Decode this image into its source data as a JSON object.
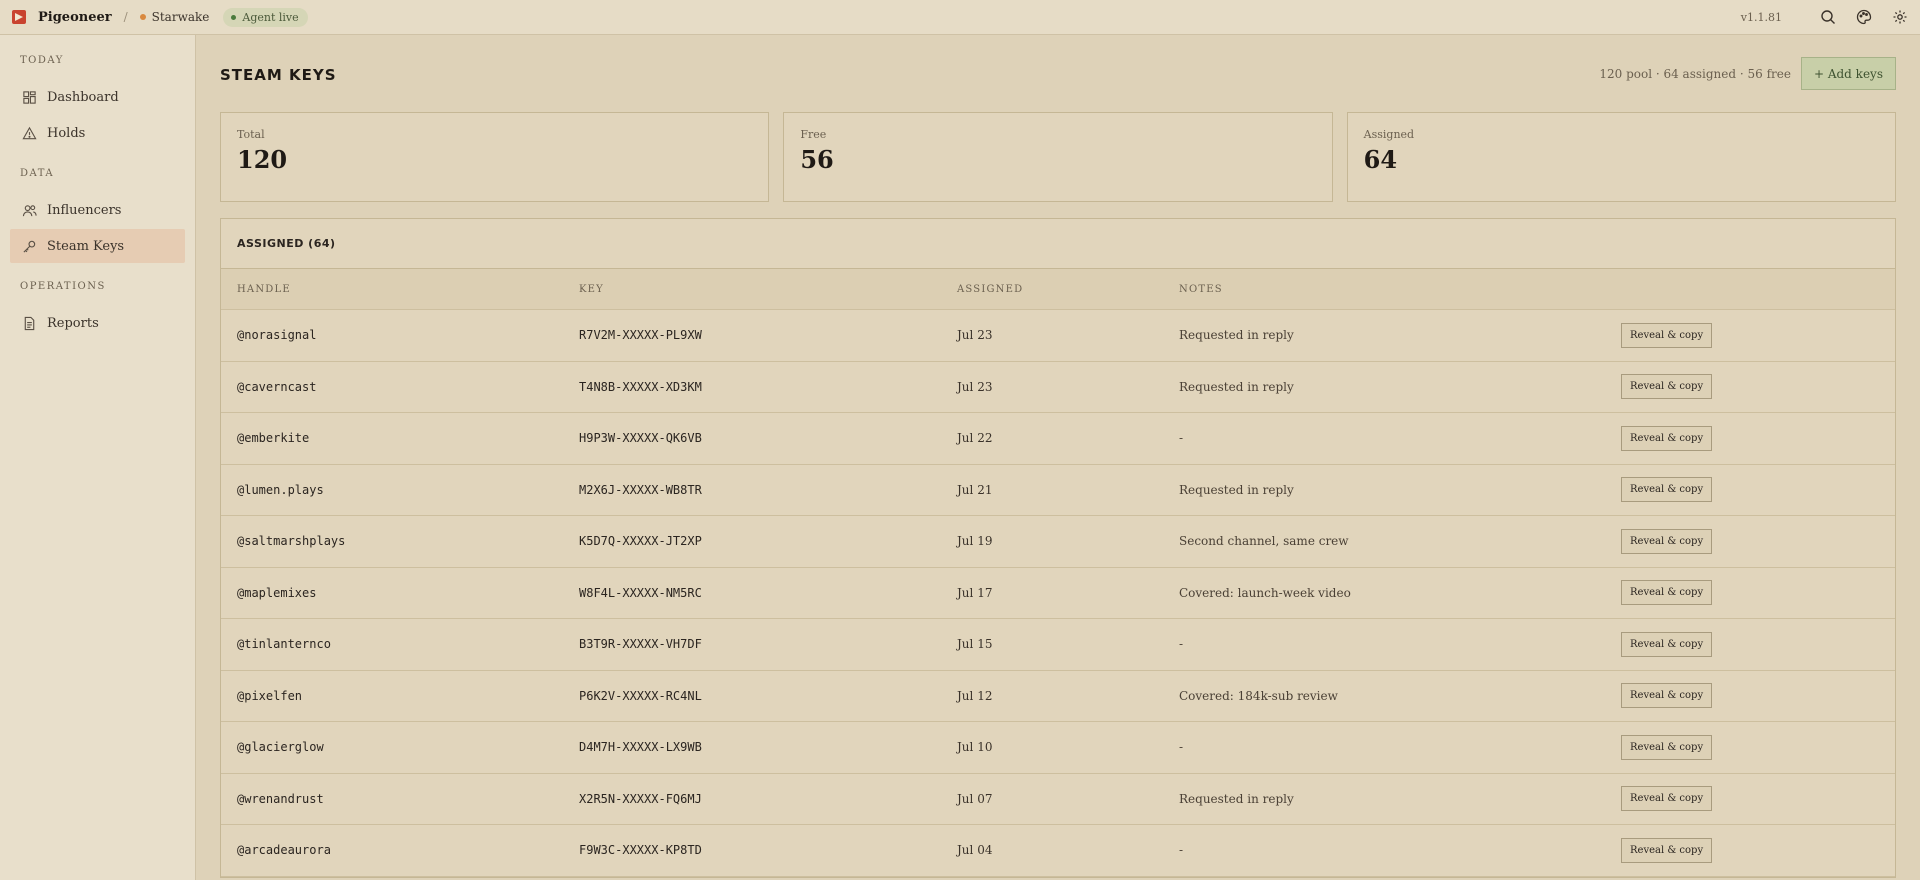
{
  "topbar": {
    "app_name": "Pigeoneer",
    "separator": "/",
    "project": "Starwake",
    "agent_status": "Agent live",
    "version": "v1.1.81"
  },
  "sidebar": {
    "sections": [
      {
        "title": "TODAY",
        "items": [
          {
            "label": "Dashboard",
            "icon": "grid-icon"
          },
          {
            "label": "Holds",
            "icon": "warning-icon"
          }
        ]
      },
      {
        "title": "DATA",
        "items": [
          {
            "label": "Influencers",
            "icon": "users-icon"
          },
          {
            "label": "Steam Keys",
            "icon": "key-icon",
            "active": true
          }
        ]
      },
      {
        "title": "OPERATIONS",
        "items": [
          {
            "label": "Reports",
            "icon": "document-icon"
          }
        ]
      }
    ]
  },
  "page": {
    "title": "STEAM KEYS",
    "pool_summary": "120 pool · 64 assigned · 56 free",
    "add_button": "+ Add keys"
  },
  "stats": [
    {
      "label": "Total",
      "value": "120"
    },
    {
      "label": "Free",
      "value": "56"
    },
    {
      "label": "Assigned",
      "value": "64"
    }
  ],
  "table": {
    "title": "ASSIGNED (64)",
    "columns": [
      "HANDLE",
      "KEY",
      "ASSIGNED",
      "NOTES"
    ],
    "action_label": "Reveal & copy",
    "rows": [
      {
        "handle": "@norasignal",
        "key": "R7V2M-XXXXX-PL9XW",
        "assigned": "Jul 23",
        "notes": "Requested in reply"
      },
      {
        "handle": "@caverncast",
        "key": "T4N8B-XXXXX-XD3KM",
        "assigned": "Jul 23",
        "notes": "Requested in reply"
      },
      {
        "handle": "@emberkite",
        "key": "H9P3W-XXXXX-QK6VB",
        "assigned": "Jul 22",
        "notes": "-"
      },
      {
        "handle": "@lumen.plays",
        "key": "M2X6J-XXXXX-WB8TR",
        "assigned": "Jul 21",
        "notes": "Requested in reply"
      },
      {
        "handle": "@saltmarshplays",
        "key": "K5D7Q-XXXXX-JT2XP",
        "assigned": "Jul 19",
        "notes": "Second channel, same crew"
      },
      {
        "handle": "@maplemixes",
        "key": "W8F4L-XXXXX-NM5RC",
        "assigned": "Jul 17",
        "notes": "Covered: launch-week video"
      },
      {
        "handle": "@tinlanternco",
        "key": "B3T9R-XXXXX-VH7DF",
        "assigned": "Jul 15",
        "notes": "-"
      },
      {
        "handle": "@pixelfen",
        "key": "P6K2V-XXXXX-RC4NL",
        "assigned": "Jul 12",
        "notes": "Covered: 184k-sub review"
      },
      {
        "handle": "@glacierglow",
        "key": "D4M7H-XXXXX-LX9WB",
        "assigned": "Jul 10",
        "notes": "-"
      },
      {
        "handle": "@wrenandrust",
        "key": "X2R5N-XXXXX-FQ6MJ",
        "assigned": "Jul 07",
        "notes": "Requested in reply"
      },
      {
        "handle": "@arcadeaurora",
        "key": "F9W3C-XXXXX-KP8TD",
        "assigned": "Jul 04",
        "notes": "-"
      }
    ]
  }
}
